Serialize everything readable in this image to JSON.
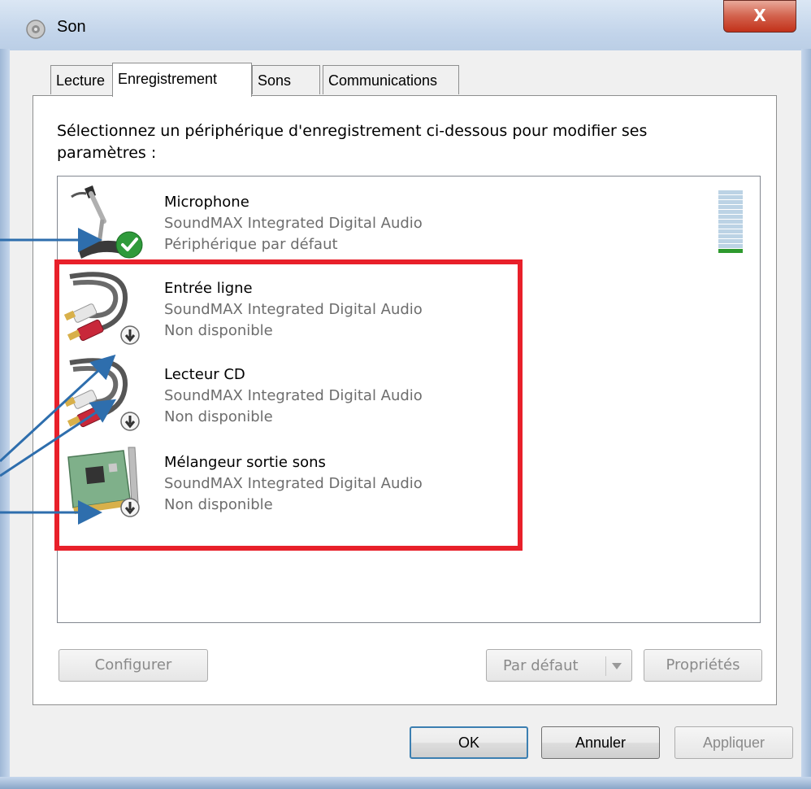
{
  "window": {
    "title": "Son",
    "close_label": "X"
  },
  "tabs": [
    {
      "label": "Lecture",
      "selected": false
    },
    {
      "label": "Enregistrement",
      "selected": true
    },
    {
      "label": "Sons",
      "selected": false
    },
    {
      "label": "Communications",
      "selected": false
    }
  ],
  "instruction": "Sélectionnez un périphérique d'enregistrement ci-dessous pour modifier ses paramètres :",
  "devices": [
    {
      "name": "Microphone",
      "driver": "SoundMAX Integrated Digital Audio",
      "status": "Périphérique par défaut",
      "icon": "microphone-icon",
      "badge": "check"
    },
    {
      "name": "Entrée ligne",
      "driver": "SoundMAX Integrated Digital Audio",
      "status": "Non disponible",
      "icon": "rca-cable-icon",
      "badge": "down-arrow"
    },
    {
      "name": "Lecteur CD",
      "driver": "SoundMAX Integrated Digital Audio",
      "status": "Non disponible",
      "icon": "rca-cable-icon",
      "badge": "down-arrow"
    },
    {
      "name": "Mélangeur sortie sons",
      "driver": "SoundMAX Integrated Digital Audio",
      "status": "Non disponible",
      "icon": "sound-card-icon",
      "badge": "down-arrow"
    }
  ],
  "level_meter": {
    "segments": 14,
    "active_segments": 1,
    "active_color": "#2e9a2e"
  },
  "panel_buttons": {
    "configure": "Configurer",
    "set_default": "Par défaut",
    "properties": "Propriétés"
  },
  "dialog_buttons": {
    "ok": "OK",
    "cancel": "Annuler",
    "apply": "Appliquer"
  },
  "colors": {
    "highlight_box": "#e8202a",
    "annotation_arrow": "#2e6ead"
  }
}
